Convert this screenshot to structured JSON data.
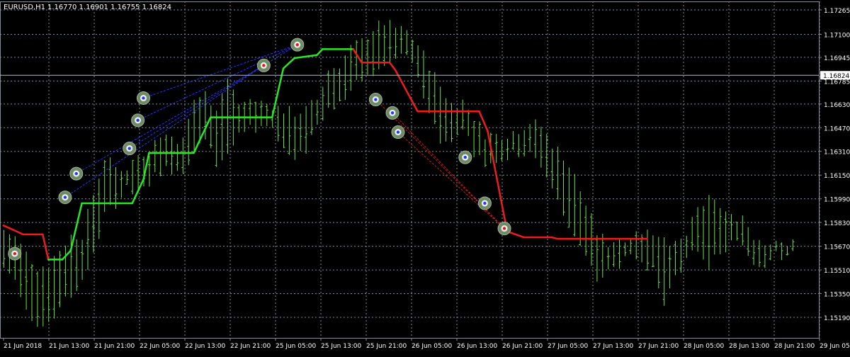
{
  "header": {
    "symbol_timeframe": "EURUSD,H1",
    "ohlc": "1.16770 1.16901 1.16755 1.16824"
  },
  "chart_data": {
    "type": "ohlc",
    "title": "EURUSD,H1",
    "xlabel": "",
    "ylabel": "",
    "ylim": [
      1.151,
      1.173
    ],
    "grid": true,
    "current_price": 1.16824,
    "y_ticks": [
      "1.17265",
      "1.17100",
      "1.16945",
      "1.16785",
      "1.16630",
      "1.16470",
      "1.16310",
      "1.16150",
      "1.15990",
      "1.15830",
      "1.15670",
      "1.15510",
      "1.15350",
      "1.15190"
    ],
    "x_ticks": [
      {
        "label": "21 Jun 2018",
        "slot": 0
      },
      {
        "label": "21 Jun 13:00",
        "slot": 4
      },
      {
        "label": "21 Jun 21:00",
        "slot": 8
      },
      {
        "label": "22 Jun 05:00",
        "slot": 12
      },
      {
        "label": "22 Jun 13:00",
        "slot": 16
      },
      {
        "label": "22 Jun 21:00",
        "slot": 20
      },
      {
        "label": "25 Jun 05:00",
        "slot": 24
      },
      {
        "label": "25 Jun 13:00",
        "slot": 28
      },
      {
        "label": "25 Jun 21:00",
        "slot": 32
      },
      {
        "label": "26 Jun 05:00",
        "slot": 36
      },
      {
        "label": "26 Jun 13:00",
        "slot": 40
      },
      {
        "label": "26 Jun 21:00",
        "slot": 44
      },
      {
        "label": "27 Jun 05:00",
        "slot": 48
      },
      {
        "label": "27 Jun 13:00",
        "slot": 52
      },
      {
        "label": "27 Jun 21:00",
        "slot": 56
      },
      {
        "label": "28 Jun 05:00",
        "slot": 60
      },
      {
        "label": "28 Jun 13:00",
        "slot": 64
      },
      {
        "label": "28 Jun 21:00",
        "slot": 68
      },
      {
        "label": "29 Jun 05:00",
        "slot": 72
      }
    ],
    "colors": {
      "background": "#000000",
      "grid": "#7f8c9a",
      "bars": "#6ee04a",
      "trend_up": "#28e828",
      "trend_down": "#ee1c1c",
      "text": "#ffffff"
    },
    "bars_anchor": [
      [
        0,
        1.1578,
        1.1552
      ],
      [
        1,
        1.1573,
        1.1545
      ],
      [
        2,
        1.1562,
        1.1527
      ],
      [
        3,
        1.1553,
        1.1513
      ],
      [
        4,
        1.1555,
        1.1512
      ],
      [
        5,
        1.1565,
        1.1527
      ],
      [
        6,
        1.1574,
        1.1533
      ],
      [
        7,
        1.1575,
        1.1545
      ],
      [
        8,
        1.1602,
        1.156
      ],
      [
        9,
        1.1627,
        1.1588
      ],
      [
        10,
        1.162,
        1.1596
      ],
      [
        11,
        1.162,
        1.1605
      ],
      [
        12,
        1.1629,
        1.16
      ],
      [
        13,
        1.1632,
        1.161
      ],
      [
        14,
        1.1643,
        1.1618
      ],
      [
        15,
        1.1641,
        1.1619
      ],
      [
        16,
        1.1638,
        1.1619
      ],
      [
        17,
        1.1666,
        1.1631
      ],
      [
        18,
        1.167,
        1.1638
      ],
      [
        19,
        1.1661,
        1.1622
      ],
      [
        20,
        1.168,
        1.163
      ],
      [
        21,
        1.1663,
        1.164
      ],
      [
        22,
        1.1666,
        1.1645
      ],
      [
        23,
        1.1664,
        1.1649
      ],
      [
        24,
        1.1662,
        1.1648
      ],
      [
        25,
        1.1659,
        1.1633
      ],
      [
        26,
        1.1657,
        1.1624
      ],
      [
        27,
        1.1659,
        1.1632
      ],
      [
        28,
        1.1666,
        1.1651
      ],
      [
        29,
        1.1686,
        1.166
      ],
      [
        30,
        1.169,
        1.1663
      ],
      [
        31,
        1.1701,
        1.1672
      ],
      [
        32,
        1.1705,
        1.1679
      ],
      [
        33,
        1.1714,
        1.1683
      ],
      [
        34,
        1.1718,
        1.1688
      ],
      [
        35,
        1.1714,
        1.1693
      ],
      [
        36,
        1.1712,
        1.1697
      ],
      [
        37,
        1.1703,
        1.1678
      ],
      [
        38,
        1.1689,
        1.1658
      ],
      [
        39,
        1.1675,
        1.1639
      ],
      [
        40,
        1.1663,
        1.1636
      ],
      [
        41,
        1.1665,
        1.1649
      ],
      [
        42,
        1.1654,
        1.1631
      ],
      [
        43,
        1.1643,
        1.1622
      ],
      [
        44,
        1.1642,
        1.1626
      ],
      [
        45,
        1.1643,
        1.1627
      ],
      [
        46,
        1.1646,
        1.163
      ],
      [
        47,
        1.1651,
        1.1628
      ],
      [
        48,
        1.1648,
        1.1622
      ],
      [
        49,
        1.1636,
        1.1606
      ],
      [
        50,
        1.1628,
        1.1588
      ],
      [
        51,
        1.1614,
        1.1575
      ],
      [
        52,
        1.1595,
        1.1559
      ],
      [
        53,
        1.1576,
        1.1544
      ],
      [
        54,
        1.1569,
        1.1549
      ],
      [
        55,
        1.1573,
        1.1555
      ],
      [
        56,
        1.1574,
        1.1558
      ],
      [
        57,
        1.1578,
        1.156
      ],
      [
        58,
        1.1576,
        1.1549
      ],
      [
        59,
        1.1575,
        1.1527
      ],
      [
        60,
        1.1567,
        1.1549
      ],
      [
        61,
        1.1574,
        1.1557
      ],
      [
        62,
        1.1592,
        1.1565
      ],
      [
        63,
        1.1598,
        1.1555
      ],
      [
        64,
        1.1594,
        1.156
      ],
      [
        65,
        1.1586,
        1.1569
      ],
      [
        66,
        1.1588,
        1.1568
      ],
      [
        67,
        1.1574,
        1.1557
      ],
      [
        68,
        1.1571,
        1.1555
      ],
      [
        69,
        1.1568,
        1.156
      ],
      [
        70,
        1.1569,
        1.1561
      ],
      [
        71,
        1.1572,
        1.1564
      ]
    ],
    "trend_line": [
      {
        "x": 0,
        "y": 1.1581
      },
      {
        "x": 3.5,
        "y": 1.1575
      },
      {
        "x": 7,
        "y": 1.1575
      },
      {
        "x": 8,
        "y": 1.1558
      },
      {
        "x": 10.5,
        "y": 1.1558
      },
      {
        "x": 12,
        "y": 1.1564
      },
      {
        "x": 14,
        "y": 1.1596
      },
      {
        "x": 23,
        "y": 1.1596
      },
      {
        "x": 25,
        "y": 1.1612
      },
      {
        "x": 26,
        "y": 1.163
      },
      {
        "x": 34,
        "y": 1.163
      },
      {
        "x": 36.5,
        "y": 1.165
      },
      {
        "x": 37,
        "y": 1.1654
      },
      {
        "x": 48,
        "y": 1.1654
      },
      {
        "x": 50,
        "y": 1.1687
      },
      {
        "x": 52,
        "y": 1.1694
      },
      {
        "x": 56,
        "y": 1.1696
      },
      {
        "x": 57,
        "y": 1.17
      },
      {
        "x": 62.5,
        "y": 1.17
      },
      {
        "x": 64,
        "y": 1.1691
      },
      {
        "x": 69,
        "y": 1.1691
      },
      {
        "x": 70,
        "y": 1.1686
      },
      {
        "x": 74,
        "y": 1.1658
      },
      {
        "x": 85,
        "y": 1.1658
      },
      {
        "x": 86.5,
        "y": 1.1645
      },
      {
        "x": 90,
        "y": 1.1577
      },
      {
        "x": 93,
        "y": 1.1573
      },
      {
        "x": 98,
        "y": 1.1573
      },
      {
        "x": 99,
        "y": 1.1572
      },
      {
        "x": 115,
        "y": 1.1572
      }
    ],
    "signals": [
      {
        "side": "sell",
        "x": 2,
        "y": 1.1562
      },
      {
        "side": "buy",
        "x": 11,
        "y": 1.16
      },
      {
        "side": "buy",
        "x": 13,
        "y": 1.1616
      },
      {
        "side": "buy",
        "x": 22.5,
        "y": 1.1633
      },
      {
        "side": "buy",
        "x": 24,
        "y": 1.1652
      },
      {
        "side": "buy",
        "x": 25,
        "y": 1.1667
      },
      {
        "side": "sell",
        "x": 46.5,
        "y": 1.1689
      },
      {
        "side": "sell",
        "x": 52.5,
        "y": 1.1703
      },
      {
        "side": "buy",
        "x": 66.5,
        "y": 1.1666
      },
      {
        "side": "buy",
        "x": 69.5,
        "y": 1.1657
      },
      {
        "side": "buy",
        "x": 70.5,
        "y": 1.1644
      },
      {
        "side": "buy",
        "x": 82.5,
        "y": 1.1627
      },
      {
        "side": "buy",
        "x": 86,
        "y": 1.1596
      },
      {
        "side": "sell",
        "x": 89.5,
        "y": 1.1579
      }
    ],
    "trades": [
      {
        "side": "buy",
        "from": {
          "x": 11,
          "y": 1.16
        },
        "to": {
          "x": 46.5,
          "y": 1.1689
        }
      },
      {
        "side": "buy",
        "from": {
          "x": 13,
          "y": 1.1616
        },
        "to": {
          "x": 46.5,
          "y": 1.1689
        }
      },
      {
        "side": "buy",
        "from": {
          "x": 22.5,
          "y": 1.1633
        },
        "to": {
          "x": 52.5,
          "y": 1.1703
        }
      },
      {
        "side": "buy",
        "from": {
          "x": 24,
          "y": 1.1652
        },
        "to": {
          "x": 52.5,
          "y": 1.1703
        }
      },
      {
        "side": "buy",
        "from": {
          "x": 25,
          "y": 1.1667
        },
        "to": {
          "x": 52.5,
          "y": 1.1703
        }
      },
      {
        "side": "sell",
        "from": {
          "x": 70.5,
          "y": 1.1644
        },
        "to": {
          "x": 89.5,
          "y": 1.1579
        }
      },
      {
        "side": "sell",
        "from": {
          "x": 69.5,
          "y": 1.1657
        },
        "to": {
          "x": 89.5,
          "y": 1.1579
        }
      },
      {
        "side": "sell",
        "from": {
          "x": 66.5,
          "y": 1.1666
        },
        "to": {
          "x": 89.5,
          "y": 1.1579
        }
      }
    ]
  }
}
